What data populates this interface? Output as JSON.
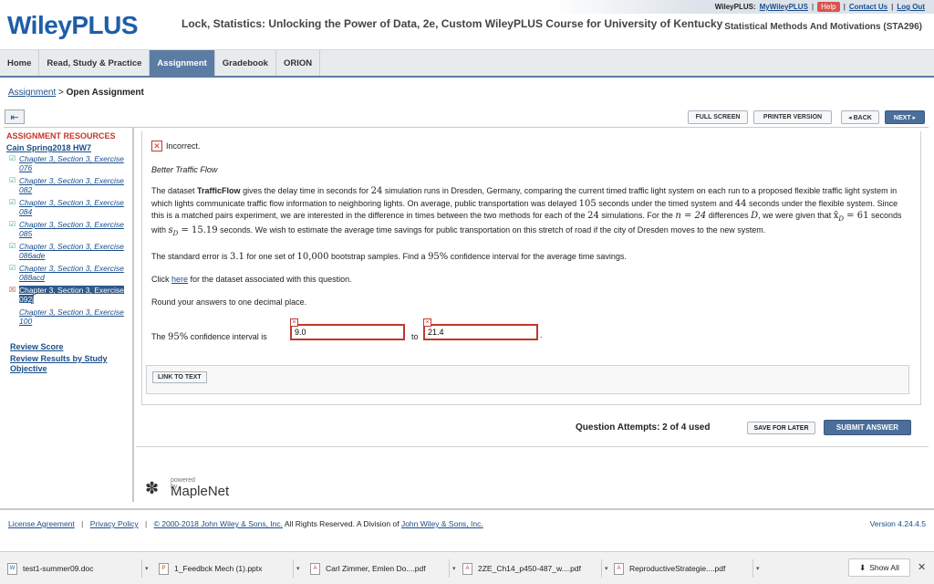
{
  "header": {
    "logo": "WileyPLUS",
    "course_title": "Lock, Statistics: Unlocking the Power of Data, 2e, Custom WileyPLUS Course for University of Kentucky",
    "course_code": "Statistical Methods And Motivations (STA296)",
    "topbar": {
      "brand": "WileyPLUS:",
      "my_link": "MyWileyPLUS",
      "help": "Help",
      "contact": "Contact Us",
      "logout": "Log Out"
    }
  },
  "nav": {
    "tabs": [
      {
        "label": "Home",
        "active": false
      },
      {
        "label": "Read, Study & Practice",
        "active": false
      },
      {
        "label": "Assignment",
        "active": true
      },
      {
        "label": "Gradebook",
        "active": false
      },
      {
        "label": "ORION",
        "active": false
      }
    ]
  },
  "breadcrumb": {
    "link": "Assignment",
    "sep": ">",
    "current": "Open Assignment"
  },
  "toolbar": {
    "toggle_icon": "⇤",
    "fullscreen": "FULL SCREEN",
    "printer": "PRINTER VERSION",
    "back": "◂ BACK",
    "next": "NEXT ▸"
  },
  "sidebar": {
    "title": "ASSIGNMENT RESOURCES",
    "assignment": "Cain Spring2018 HW7",
    "items": [
      {
        "label": "Chapter 3, Section 3, Exercise 076",
        "status": "correct"
      },
      {
        "label": "Chapter 3, Section 3, Exercise 082",
        "status": "correct"
      },
      {
        "label": "Chapter 3, Section 3, Exercise 084",
        "status": "correct"
      },
      {
        "label": "Chapter 3, Section 3, Exercise 085",
        "status": "correct"
      },
      {
        "label": "Chapter 3, Section 3, Exercise 086ade",
        "status": "correct"
      },
      {
        "label": "Chapter 3, Section 3, Exercise 088acd",
        "status": "correct"
      },
      {
        "label": "Chapter 3, Section 3, Exercise 092j",
        "status": "incorrect",
        "active": true
      },
      {
        "label": "Chapter 3, Section 3, Exercise 100",
        "status": "none"
      }
    ],
    "review_score": "Review Score",
    "review_results": "Review Results by Study Objective"
  },
  "question": {
    "result": "Incorrect.",
    "title": "Better Traffic Flow",
    "p1_a": "The dataset ",
    "p1_dataset": "TrafficFlow",
    "p1_b": " gives the delay time in seconds for ",
    "p1_n1": "24",
    "p1_c": " simulation runs in Dresden, Germany, comparing the current timed traffic light system on each run to a proposed flexible traffic light system in which lights communicate traffic flow information to neighboring lights. On average, public transportation was delayed ",
    "p1_n2": "105",
    "p1_d": " seconds under the timed system and ",
    "p1_n3": "44",
    "p1_e": " seconds under the flexible system. Since this is a matched pairs experiment, we are interested in the difference in times between the two methods for each of the ",
    "p1_n4": "24",
    "p1_f": " simulations. For the ",
    "p1_m1": "n = 24",
    "p1_g": " differences ",
    "p1_m2": "D",
    "p1_h": ", we were given that ",
    "p1_m3": "x̄",
    "p1_m3sub": "D",
    "p1_m3val": " = 61",
    "p1_i": " seconds with ",
    "p1_m4": "s",
    "p1_m4sub": "D",
    "p1_m4val": " = 15.19",
    "p1_j": " seconds. We wish to estimate the average time savings for public transportation on this stretch of road if the city of Dresden moves to the new system.",
    "p2_a": "The standard error is ",
    "p2_se": "3.1",
    "p2_b": " for one set of ",
    "p2_n": "10,000",
    "p2_c": " bootstrap samples. Find a ",
    "p2_pct": "95%",
    "p2_d": " confidence interval for the average time savings.",
    "p3_a": "Click ",
    "p3_link": "here",
    "p3_b": " for the dataset associated with this question.",
    "p4": "Round your answers to one decimal place.",
    "ci_label_a": "The ",
    "ci_pct": "95%",
    "ci_label_b": " confidence interval is",
    "answer1": "9.0",
    "to": "to",
    "answer2": "21.4",
    "period": ".",
    "link_to_text": "LINK TO TEXT"
  },
  "actions": {
    "attempts": "Question Attempts: 2 of 4 used",
    "save_later": "SAVE FOR LATER",
    "submit": "SUBMIT ANSWER"
  },
  "powered": {
    "label": "powered by",
    "brand": "MapleNet"
  },
  "footer": {
    "license": "License Agreement",
    "privacy": "Privacy Policy",
    "copyright_link": "© 2000-2018 John Wiley & Sons, Inc.",
    "rights": " All Rights Reserved. A Division of ",
    "wiley_link": "John Wiley & Sons, Inc.",
    "version": "Version 4.24.4.5"
  },
  "downloads": {
    "items": [
      {
        "name": "test1-summer09.doc",
        "type": "word"
      },
      {
        "name": "1_Feedbck Mech (1).pptx",
        "type": "ppt"
      },
      {
        "name": "Carl Zimmer, Emlen Do....pdf",
        "type": "pdf"
      },
      {
        "name": "2ZE_Ch14_p450-487_w....pdf",
        "type": "pdf"
      },
      {
        "name": "ReproductiveStrategie....pdf",
        "type": "pdf"
      }
    ],
    "show_all": "Show All"
  }
}
